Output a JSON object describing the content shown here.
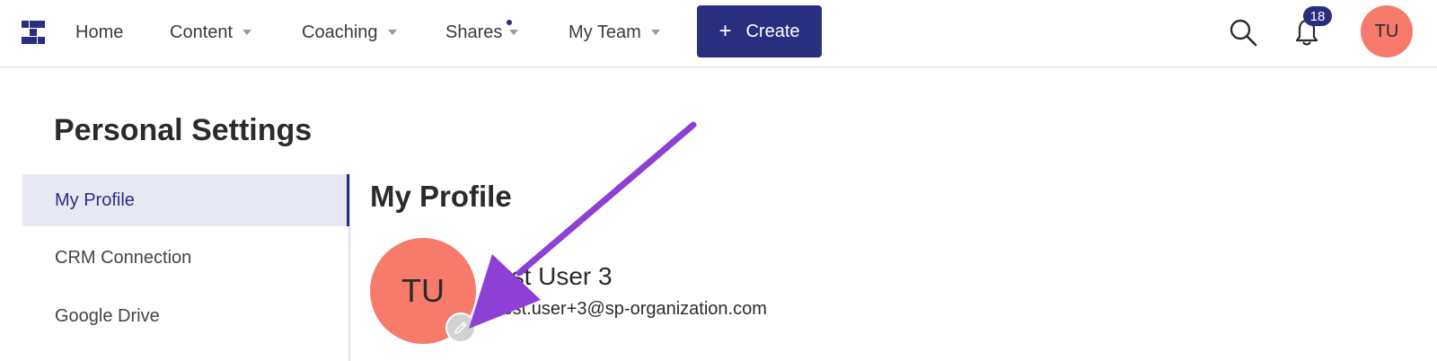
{
  "nav": {
    "items": [
      {
        "label": "Home",
        "has_dropdown": false
      },
      {
        "label": "Content",
        "has_dropdown": true
      },
      {
        "label": "Coaching",
        "has_dropdown": true
      },
      {
        "label": "Shares",
        "has_dropdown": true
      },
      {
        "label": "My Team",
        "has_dropdown": true
      }
    ],
    "create_label": "Create",
    "create_icon": "+",
    "notifications_count": "18",
    "user_initials": "TU"
  },
  "page": {
    "title": "Personal Settings"
  },
  "sidebar": {
    "items": [
      {
        "label": "My Profile",
        "active": true
      },
      {
        "label": "CRM Connection",
        "active": false
      },
      {
        "label": "Google Drive",
        "active": false
      }
    ]
  },
  "profile": {
    "section_title": "My Profile",
    "initials": "TU",
    "name": "est User 3",
    "email": "test.user+3@sp-organization.com"
  },
  "colors": {
    "brand": "#2a2e7f",
    "avatar": "#f77a6b",
    "annotation_arrow": "#8e3fd6"
  },
  "icons": [
    "logo-icon",
    "caret-down-icon",
    "plus-icon",
    "search-icon",
    "bell-icon",
    "pencil-icon",
    "annotation-arrow"
  ]
}
